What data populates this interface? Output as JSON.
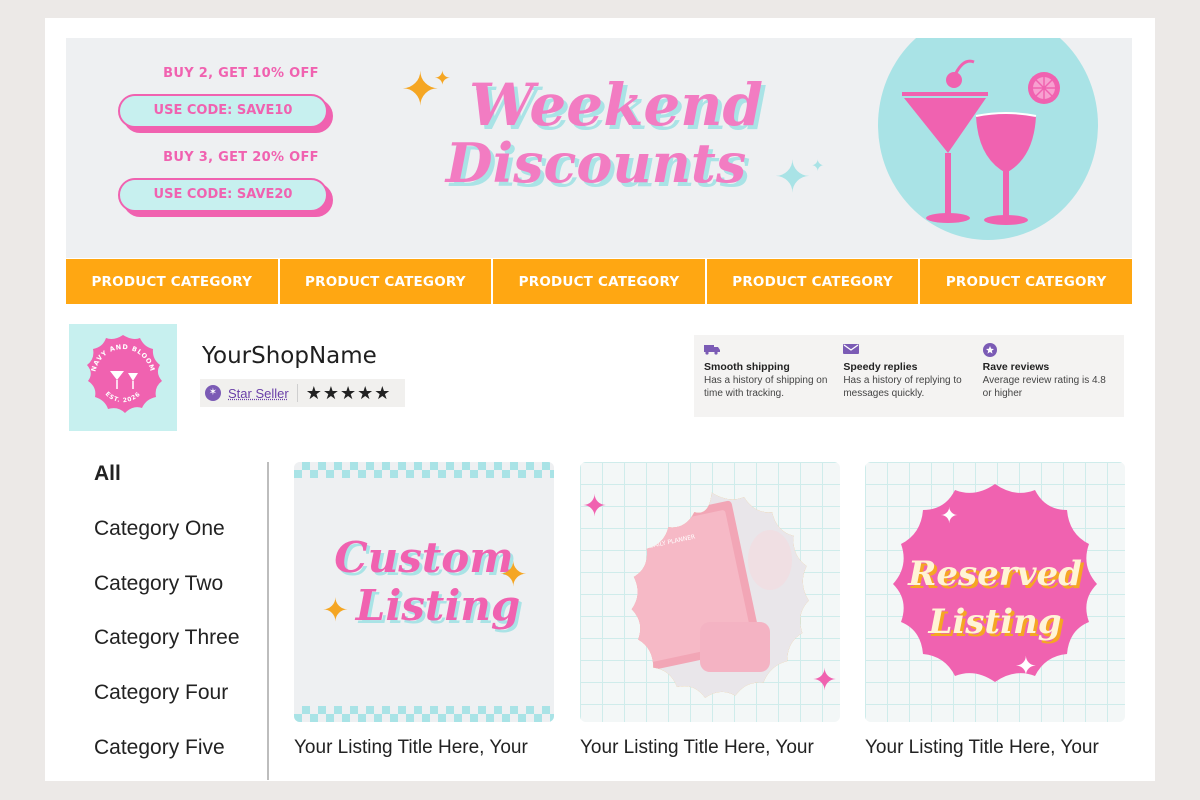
{
  "banner": {
    "promo1": "BUY 2, GET 10% OFF",
    "code1": "USE CODE: SAVE10",
    "promo2": "BUY 3, GET 20% OFF",
    "code2": "USE CODE: SAVE20",
    "headline_line1": "Weekend",
    "headline_line2": "Discounts"
  },
  "category_bar": [
    {
      "label": "PRODUCT CATEGORY"
    },
    {
      "label": "PRODUCT CATEGORY"
    },
    {
      "label": "PRODUCT CATEGORY"
    },
    {
      "label": "PRODUCT CATEGORY"
    },
    {
      "label": "PRODUCT CATEGORY"
    }
  ],
  "shop": {
    "name": "YourShopName",
    "star_seller": "Star Seller",
    "rating_stars": "★★★★★",
    "logo_text_top": "NAVY AND BLOOM",
    "logo_text_bottom": "EST. 2026"
  },
  "features": [
    {
      "icon": "truck-icon",
      "title": "Smooth shipping",
      "desc": "Has a history of shipping on time with tracking."
    },
    {
      "icon": "message-icon",
      "title": "Speedy replies",
      "desc": "Has a history of replying to messages quickly."
    },
    {
      "icon": "star-badge-icon",
      "title": "Rave reviews",
      "desc": "Average review rating is 4.8 or higher"
    }
  ],
  "sidebar": {
    "items": [
      {
        "label": "All"
      },
      {
        "label": "Category One"
      },
      {
        "label": "Category Two"
      },
      {
        "label": "Category Three"
      },
      {
        "label": "Category Four"
      },
      {
        "label": "Category Five"
      }
    ]
  },
  "listings": [
    {
      "image_line1": "Custom",
      "image_line2": "Listing",
      "title": "Your Listing Title Here, Your"
    },
    {
      "image_label": "DAILY PLANNER",
      "title": "Your Listing Title Here, Your"
    },
    {
      "image_line1": "Reserved",
      "image_line2": "Listing",
      "title": "Your Listing Title Here, Your"
    }
  ],
  "colors": {
    "pink": "#f062b0",
    "aqua": "#a9e3e6",
    "orange": "#ffa712",
    "purple": "#7b5bb5"
  }
}
